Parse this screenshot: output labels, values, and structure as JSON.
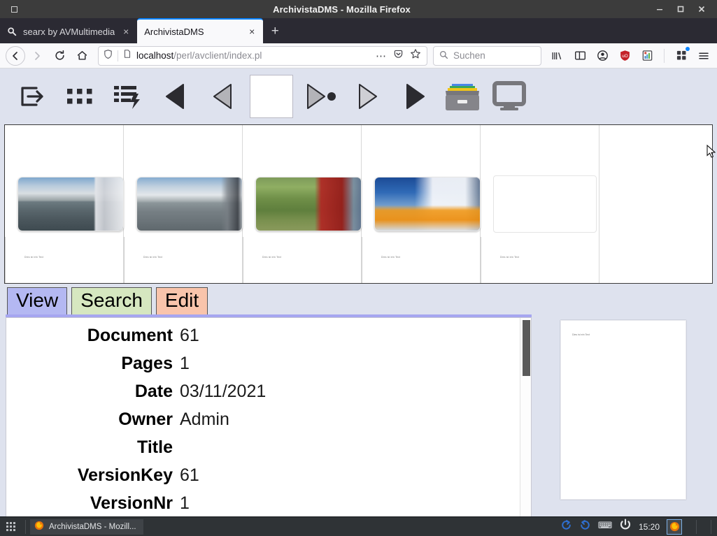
{
  "window": {
    "title": "ArchivistaDMS - Mozilla Firefox",
    "minimize_label": "–",
    "maximize_label": "□",
    "close_label": "×"
  },
  "browser": {
    "tabs": [
      {
        "label": "searx by AVMultimedia",
        "icon": "search-favicon",
        "active": false,
        "close_label": "×"
      },
      {
        "label": "ArchivistaDMS",
        "icon": "page-favicon",
        "active": true,
        "close_label": "×"
      }
    ],
    "new_tab_label": "+",
    "nav": {
      "back_label": "←",
      "forward_label": "→",
      "reload_label": "↻",
      "home_label": "⌂"
    },
    "url": {
      "host": "localhost",
      "path": "/perl/avclient/index.pl",
      "shield_icon": "tracking-protection-icon",
      "page_icon": "page-info-icon",
      "more_label": "⋯",
      "pocket_icon": "pocket-icon",
      "bookmark_icon": "star-icon"
    },
    "search": {
      "placeholder": "Suchen",
      "icon": "search-icon"
    },
    "toolbar_icons": [
      "library-icon",
      "sidebar-icon",
      "account-icon",
      "ublock-origin-icon",
      "extension-icon",
      "extensions-puzzle-icon",
      "app-menu-icon"
    ]
  },
  "app": {
    "toolbar": [
      {
        "name": "login-icon",
        "label": "Login"
      },
      {
        "name": "grid-icon",
        "label": "Thumbnails"
      },
      {
        "name": "list-lightning-icon",
        "label": "Quick list"
      },
      {
        "name": "first-page-icon",
        "label": "First page"
      },
      {
        "name": "prev-page-icon",
        "label": "Previous page"
      },
      {
        "name": "page-number-field",
        "label": "",
        "value": ""
      },
      {
        "name": "next-page-dot-icon",
        "label": "Next page"
      },
      {
        "name": "forward-icon",
        "label": "Forward"
      },
      {
        "name": "last-page-icon",
        "label": "Last page"
      },
      {
        "name": "archive-box-icon",
        "label": "Archive"
      },
      {
        "name": "monitor-icon",
        "label": "Display"
      }
    ],
    "thumbnails": [
      {
        "caption": "Dies ist ein Text",
        "photo": "ph1"
      },
      {
        "caption": "Dies ist ein Text",
        "photo": "ph2"
      },
      {
        "caption": "Dies ist ein Text",
        "photo": "ph3"
      },
      {
        "caption": "Dies ist ein Text",
        "photo": "ph4"
      },
      {
        "caption": "Dies ist ein Text",
        "photo": ""
      }
    ],
    "tabs": [
      {
        "label": "View",
        "color": "#b4b8f2",
        "active": true
      },
      {
        "label": "Search",
        "color": "#d6e7c0",
        "active": false
      },
      {
        "label": "Edit",
        "color": "#f9c4ab",
        "active": false
      }
    ],
    "fields": [
      {
        "label": "Document",
        "value": "61"
      },
      {
        "label": "Pages",
        "value": "1"
      },
      {
        "label": "Date",
        "value": "03/11/2021"
      },
      {
        "label": "Owner",
        "value": "Admin"
      },
      {
        "label": "Title",
        "value": ""
      },
      {
        "label": "VersionKey",
        "value": "61"
      },
      {
        "label": "VersionNr",
        "value": "1"
      }
    ],
    "preview": {
      "text": "Dies ist ein Text"
    }
  },
  "taskbar": {
    "menu_icon": "app-grid-icon",
    "window_button": {
      "label": "ArchivistaDMS - Mozill...",
      "icon": "firefox-icon"
    },
    "tray": [
      {
        "name": "refresh-forward-icon",
        "color": "#2f6fd0"
      },
      {
        "name": "refresh-back-icon",
        "color": "#2f6fd0"
      },
      {
        "name": "keyboard-icon",
        "color": "#cfd2d6"
      },
      {
        "name": "power-icon",
        "color": "#e6e8ea"
      }
    ],
    "clock": "15:20",
    "tray_app": {
      "name": "firefox-tray-icon"
    }
  }
}
